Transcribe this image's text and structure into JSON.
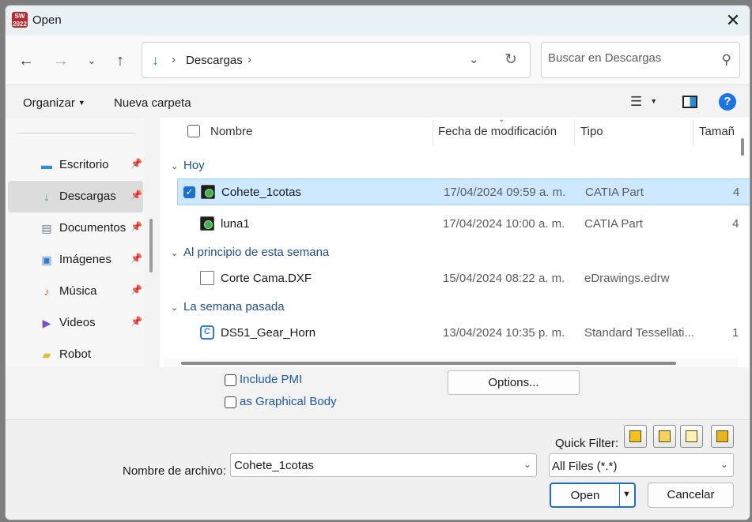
{
  "window": {
    "title": "Open",
    "app_icon_text": "SW 2022"
  },
  "nav": {
    "address_segment": "Descargas",
    "search_placeholder": "Buscar en Descargas"
  },
  "toolbar": {
    "organize_label": "Organizar",
    "new_folder_label": "Nueva carpeta"
  },
  "sidebar": {
    "items": [
      {
        "label": "Escritorio",
        "icon": "desktop-icon",
        "pinned": true,
        "color": "#2b90d9"
      },
      {
        "label": "Descargas",
        "icon": "download-icon",
        "pinned": true,
        "selected": true,
        "color": "#1a9e6d"
      },
      {
        "label": "Documentos",
        "icon": "document-icon",
        "pinned": true,
        "color": "#6b7b8c"
      },
      {
        "label": "Imágenes",
        "icon": "image-icon",
        "pinned": true,
        "color": "#2a7fd4"
      },
      {
        "label": "Música",
        "icon": "music-icon",
        "pinned": true,
        "color": "#e8623a"
      },
      {
        "label": "Videos",
        "icon": "video-icon",
        "pinned": true,
        "color": "#7a4bd1"
      },
      {
        "label": "Robot",
        "icon": "folder-icon",
        "pinned": false,
        "color": "#f0b429"
      }
    ]
  },
  "columns": {
    "name": "Nombre",
    "modified": "Fecha de modificación",
    "type": "Tipo",
    "size": "Tamañ"
  },
  "groups": [
    {
      "label": "Hoy"
    },
    {
      "label": "Al principio de esta semana"
    },
    {
      "label": "La semana pasada"
    }
  ],
  "files": [
    {
      "name": "Cohete_1cotas",
      "modified": "17/04/2024 09:59 a. m.",
      "type": "CATIA Part",
      "size": "4",
      "icon": "catia-part-icon",
      "selected": true
    },
    {
      "name": "luna1",
      "modified": "17/04/2024 10:00 a. m.",
      "type": "CATIA Part",
      "size": "4",
      "icon": "catia-part-icon"
    },
    {
      "name": "Corte Cama.DXF",
      "modified": "15/04/2024 08:22 a. m.",
      "type": "eDrawings.edrw",
      "size": "",
      "icon": "blank-document-icon"
    },
    {
      "name": "DS51_Gear_Horn",
      "modified": "13/04/2024 10:35 p. m.",
      "type": "Standard Tessellati...",
      "size": "1",
      "icon": "tessellation-file-icon"
    }
  ],
  "options": {
    "include_pmi_label": "Include PMI",
    "graphical_body_label": "as Graphical Body",
    "options_button": "Options..."
  },
  "footer": {
    "quick_filter_label": "Quick Filter:",
    "filename_label": "Nombre de archivo:",
    "filename_value": "Cohete_1cotas",
    "filetype_value": "All Files (*.*)",
    "open_label": "Open",
    "cancel_label": "Cancelar"
  }
}
